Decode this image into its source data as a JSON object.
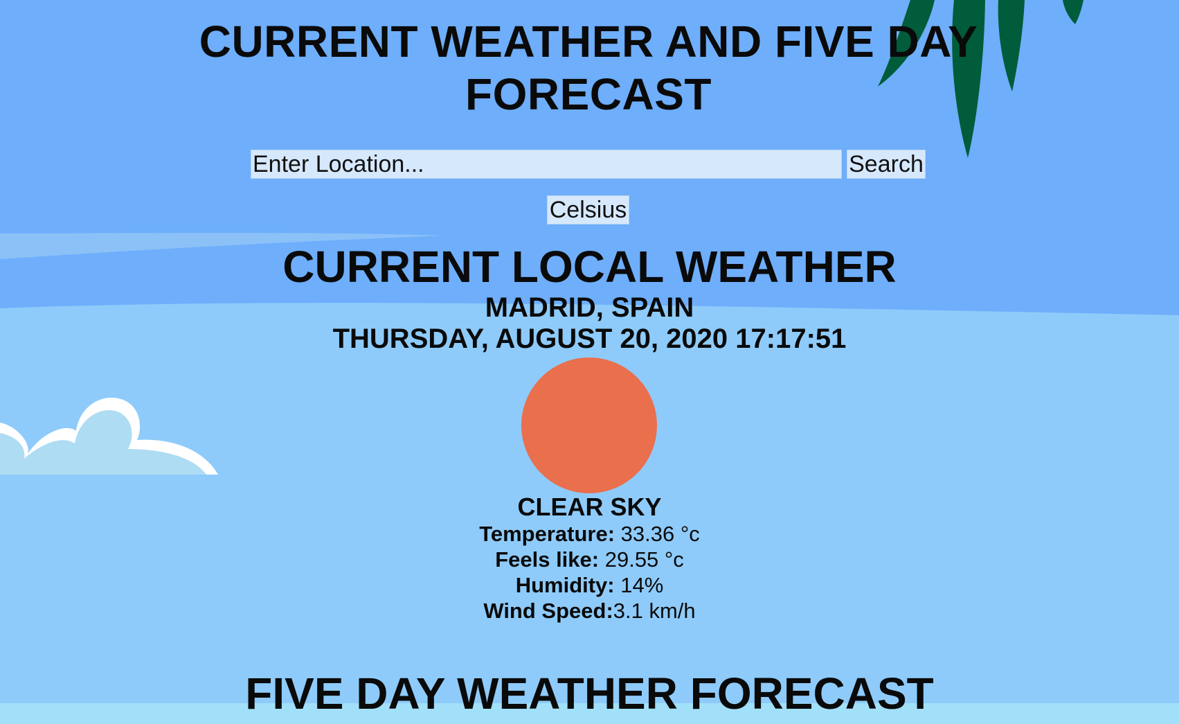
{
  "header": {
    "title": "CURRENT WEATHER AND FIVE DAY FORECAST"
  },
  "search": {
    "placeholder": "Enter Location...",
    "button_label": "Search"
  },
  "unit_toggle": {
    "label": "Celsius"
  },
  "current": {
    "heading": "CURRENT LOCAL WEATHER",
    "location": "MADRID, SPAIN",
    "datetime": "THURSDAY, AUGUST 20, 2020 17:17:51",
    "icon": "sun-icon",
    "condition": "CLEAR SKY",
    "stats": [
      {
        "label": "Temperature:",
        "value": " 33.36 °c"
      },
      {
        "label": "Feels like:",
        "value": " 29.55 °c"
      },
      {
        "label": "Humidity:",
        "value": " 14%"
      },
      {
        "label": "Wind Speed:",
        "value": "3.1 km/h"
      }
    ]
  },
  "forecast": {
    "heading": "FIVE DAY WEATHER FORECAST"
  },
  "colors": {
    "sky_top": "#6eaefb",
    "sky_bottom": "#8ecbfa",
    "sun": "#ea6f4d",
    "leaf": "#005c3a",
    "cloud": "#ffffff",
    "input_bg": "#d6e8fc"
  }
}
